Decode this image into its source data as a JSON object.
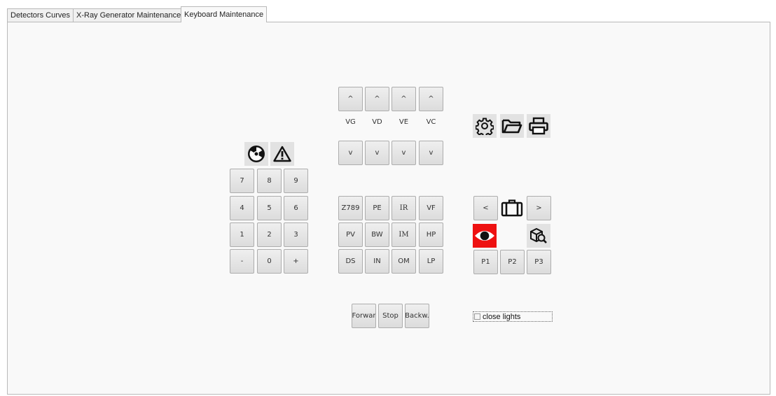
{
  "tabs": [
    {
      "label": "Detectors Curves"
    },
    {
      "label": "X-Ray Generator Maintenance"
    },
    {
      "label": "Keyboard Maintenance",
      "active": true
    }
  ],
  "voltage": {
    "up_label": "^",
    "down_label": "v",
    "labels": [
      "VG",
      "VD",
      "VE",
      "VC"
    ]
  },
  "hazard_icons": [
    "radiation-icon",
    "warning-icon"
  ],
  "numpad": {
    "keys": [
      "7",
      "8",
      "9",
      "4",
      "5",
      "6",
      "1",
      "2",
      "3",
      "-",
      "0",
      "+"
    ]
  },
  "functions": {
    "keys": [
      "Z789",
      "PE",
      "IR",
      "VF",
      "PV",
      "BW",
      "IM",
      "HP",
      "DS",
      "IN",
      "OM",
      "LP"
    ]
  },
  "tools_icons": [
    "gear-icon",
    "folder-icon",
    "printer-icon"
  ],
  "luggage_nav": {
    "prev_label": "<",
    "next_label": ">",
    "center_icon": "luggage-icon",
    "eye_icon": "eye-icon",
    "eye_bg": "#ee1111",
    "search_icon": "package-search-icon"
  },
  "presets": [
    "P1",
    "P2",
    "P3"
  ],
  "conveyor": {
    "forward_label": "Forwar",
    "stop_label": "Stop",
    "backward_label": "Backw."
  },
  "close_lights": {
    "label": "close lights",
    "checked": false
  }
}
